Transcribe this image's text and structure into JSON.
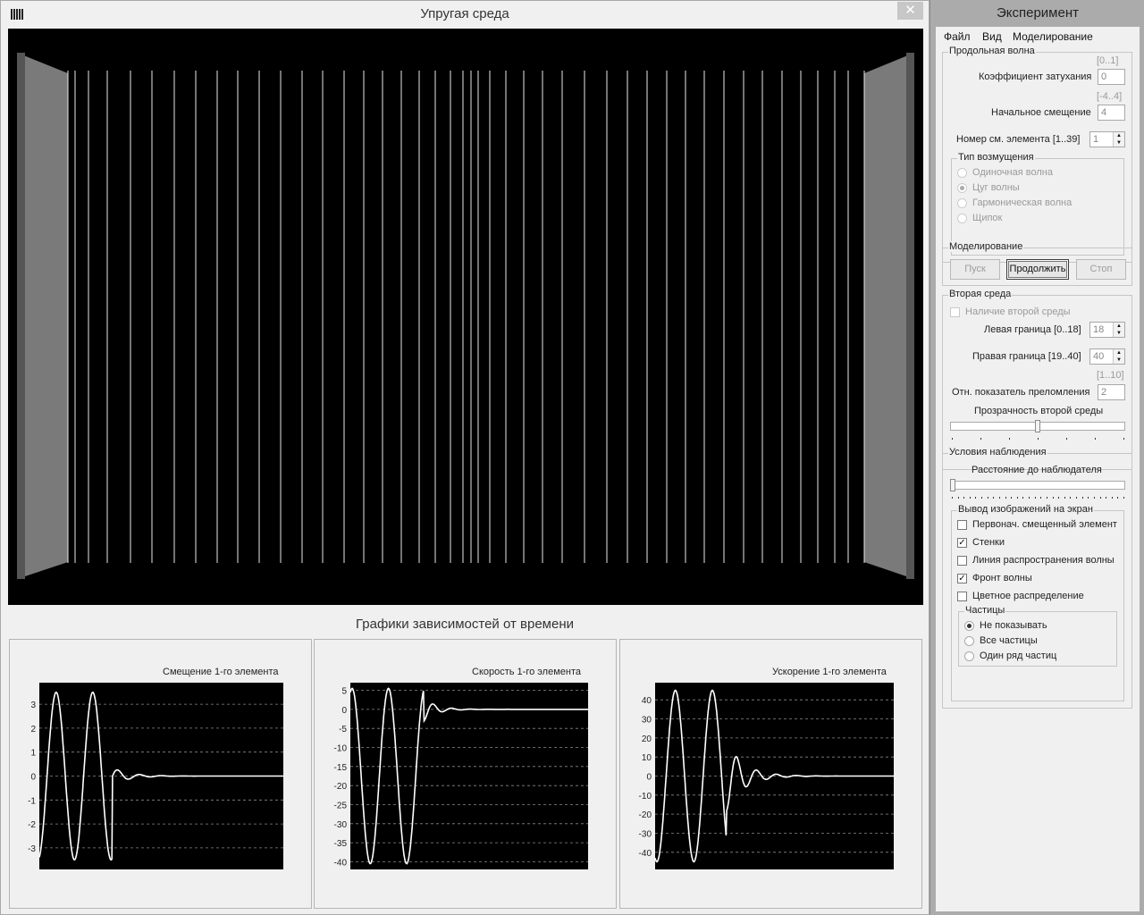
{
  "left_window": {
    "title": "Упругая среда",
    "close_glyph": "✕",
    "graphs_title": "Графики зависимостей от времени"
  },
  "graphs": [
    {
      "title": "Смещение 1-го элемента",
      "yticks": [
        "3",
        "2",
        "1",
        "0",
        "-1",
        "-2",
        "-3"
      ],
      "ylim": [
        -3.9,
        3.9
      ]
    },
    {
      "title": "Скорость 1-го элемента",
      "yticks": [
        "5",
        "0",
        "-5",
        "-10",
        "-15",
        "-20",
        "-25",
        "-30",
        "-35",
        "-40"
      ],
      "ylim": [
        -42,
        7
      ]
    },
    {
      "title": "Ускорение 1-го элемента",
      "yticks": [
        "40",
        "30",
        "20",
        "10",
        "0",
        "-10",
        "-20",
        "-30",
        "-40"
      ],
      "ylim": [
        -49,
        49
      ]
    }
  ],
  "right_window": {
    "title": "Эксперимент",
    "menu": [
      "Файл",
      "Вид",
      "Моделирование"
    ],
    "long_wave": {
      "legend": "Продольная волна",
      "damping_range": "[0..1]",
      "damping_label": "Коэффициент затухания",
      "damping_value": "0",
      "offset_range": "[-4..4]",
      "offset_label": "Начальное смещение",
      "offset_value": "4",
      "element_label": "Номер см. элемента  [1..39]",
      "element_value": "1",
      "disturbance": {
        "legend": "Тип возмущения",
        "options": [
          "Одиночная волна",
          "Цуг волны",
          "Гармоническая волна",
          "Щипок"
        ],
        "selected": 1
      }
    },
    "modeling": {
      "legend": "Моделирование",
      "start": "Пуск",
      "continue": "Продолжить",
      "stop": "Стоп"
    },
    "second_medium": {
      "legend": "Вторая среда",
      "presence_label": "Наличие второй среды",
      "left_label": "Левая граница  [0..18]",
      "left_value": "18",
      "right_label": "Правая граница  [19..40]",
      "right_value": "40",
      "index_range": "[1..10]",
      "index_label": "Отн. показатель преломления",
      "index_value": "2",
      "transparency_label": "Прозрачность второй среды",
      "transparency_level": 0.5
    },
    "observation": {
      "legend": "Условия наблюдения",
      "distance_label": "Расстояние до наблюдателя",
      "distance_level": 0.0,
      "output": {
        "legend": "Вывод изображений на экран",
        "items": [
          {
            "label": "Первонач. смещенный элемент",
            "checked": false
          },
          {
            "label": "Стенки",
            "checked": true
          },
          {
            "label": "Линия распространения волны",
            "checked": false
          },
          {
            "label": "Фронт волны",
            "checked": true
          },
          {
            "label": "Цветное распределение",
            "checked": false
          }
        ],
        "particles": {
          "legend": "Частицы",
          "options": [
            "Не показывать",
            "Все частицы",
            "Один ряд частиц"
          ],
          "selected": 0
        }
      }
    }
  }
}
